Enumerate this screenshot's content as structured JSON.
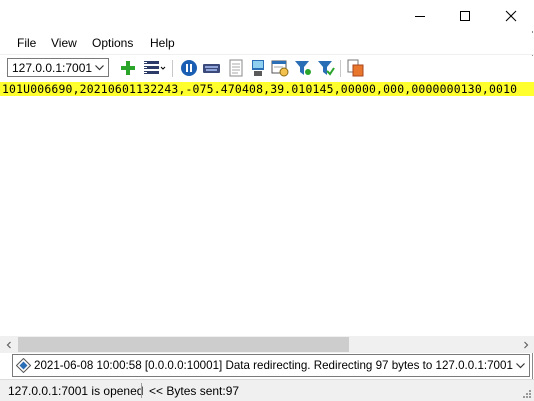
{
  "window": {
    "title": "",
    "controls": [
      "minimize-icon",
      "maximize-icon",
      "close-icon"
    ]
  },
  "menu": {
    "items": [
      {
        "label": "File"
      },
      {
        "label": "View"
      },
      {
        "label": "Options"
      },
      {
        "label": "Help"
      }
    ]
  },
  "toolbar": {
    "address": "127.0.0.1:7001",
    "icons": [
      "add-icon",
      "columns-icon",
      "pause-icon",
      "serial-port-icon",
      "document-icon",
      "computer-icon",
      "schedule-icon",
      "filter-icon",
      "filter-apply-icon",
      "copy-icon"
    ]
  },
  "data_line": "101U006690,20210601132243,-075.470408,39.010145,00000,000,0000000130,0010",
  "log": {
    "selected": "2021-06-08 10:00:58 [0.0.0.0:10001] Data redirecting. Redirecting 97 bytes to 127.0.0.1:7001"
  },
  "status": {
    "connection": "127.0.0.1:7001 is opened",
    "bytes": "<< Bytes sent:97"
  },
  "colors": {
    "highlight": "#ffff2e",
    "add": "#2aa52a",
    "accent": "#1a5fb4",
    "copy": "#e8762c"
  }
}
